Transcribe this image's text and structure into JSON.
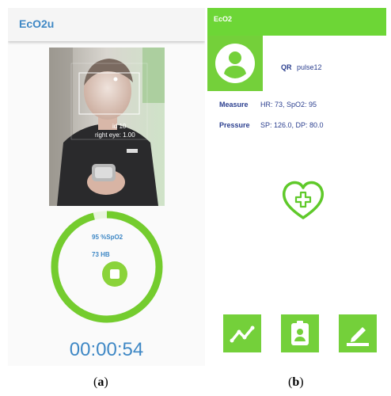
{
  "panel_a": {
    "app_title": "EcO2u",
    "camera_overlay": {
      "id_text": "id 10",
      "eye_text": "right eye: 1.00"
    },
    "spo2_reading": "95 %SpO2",
    "heart_beat_reading": "73 HB",
    "ring_progress": 0.96,
    "timer": "00:00:54"
  },
  "panel_b": {
    "app_title": "EcO2",
    "qr_label": "QR",
    "qr_value": "pulse12",
    "measure_label": "Measure",
    "measure_value": "HR: 73, SpO2: 95",
    "pressure_label": "Pressure",
    "pressure_value": "SP: 126.0, DP: 80.0"
  },
  "captions": {
    "a_open": "(",
    "a_letter": "a",
    "a_close": ")",
    "b_open": "(",
    "b_letter": "b",
    "b_close": ")"
  },
  "colors": {
    "accent_blue": "#3f88c5",
    "navy_text": "#2b3f8f",
    "green": "#6dd636"
  }
}
